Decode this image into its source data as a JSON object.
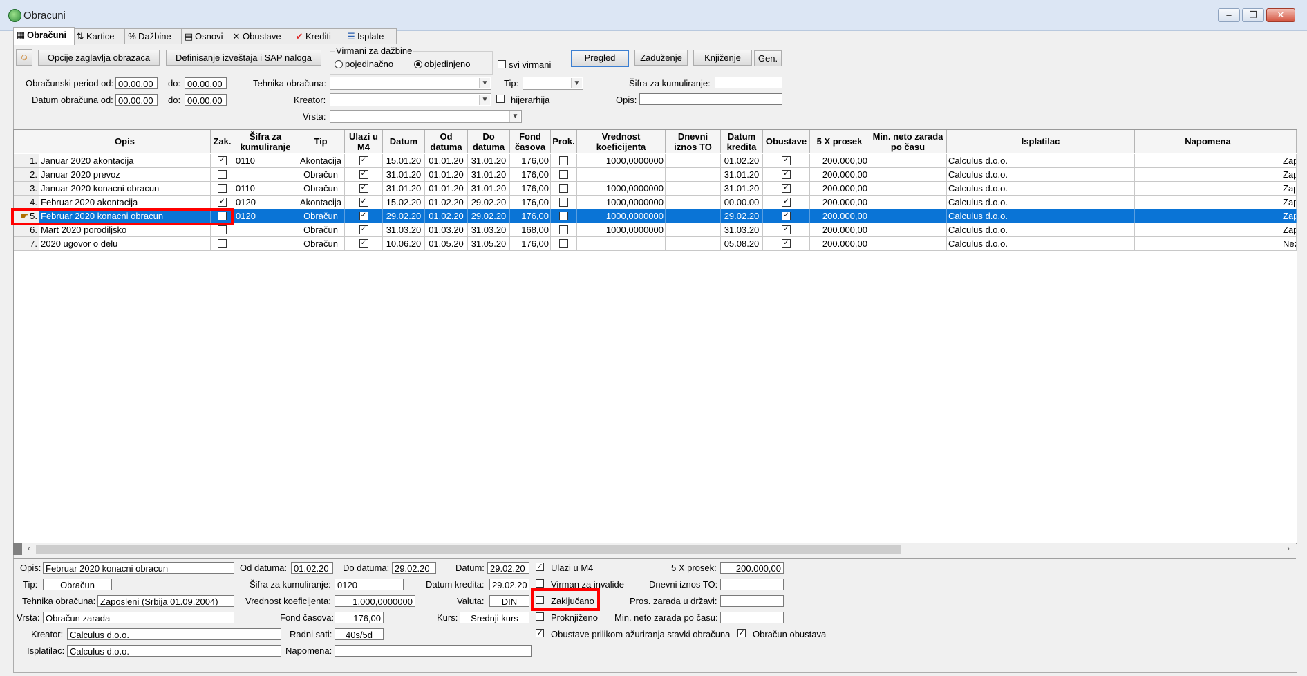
{
  "window": {
    "title": "Obracuni",
    "controls": [
      "–",
      "❐",
      "✕"
    ]
  },
  "tabs": [
    {
      "label": "Obračuni",
      "icon": "table-icon",
      "glyph": "▦"
    },
    {
      "label": "Kartice",
      "icon": "sort-icon",
      "glyph": "⇅"
    },
    {
      "label": "Dažbine",
      "icon": "percent-icon",
      "glyph": "%"
    },
    {
      "label": "Osnovi",
      "icon": "folder-icon",
      "glyph": "▤"
    },
    {
      "label": "Obustave",
      "icon": "cross-icon",
      "glyph": "✕"
    },
    {
      "label": "Krediti",
      "icon": "checkmark-icon",
      "glyph": "✔"
    },
    {
      "label": "Isplate",
      "icon": "stack-icon",
      "glyph": "☰"
    }
  ],
  "toolbar": {
    "opcije_label": "Opcije zaglavlja obrazaca",
    "definisanje_label": "Definisanje izveštaja i SAP naloga",
    "virmani_group": "Virmani za dažbine",
    "pojedinacno": "pojedinačno",
    "objedinjeno": "objedinjeno",
    "svi_virmani": "svi virmani",
    "pregled": "Pregled",
    "zaduzenje": "Zaduženje",
    "knjizenje": "Knjiženje",
    "gen": "Gen."
  },
  "filters": {
    "period_label": "Obračunski period od:",
    "period_od": "00.00.00",
    "do_label": "do:",
    "period_do": "00.00.00",
    "datum_label": "Datum obračuna od:",
    "datum_od": "00.00.00",
    "datum_do": "00.00.00",
    "tehnika_label": "Tehnika obračuna:",
    "kreator_label": "Kreator:",
    "vrsta_label": "Vrsta:",
    "tip_label": "Tip:",
    "hijerarhija": "hijerarhija",
    "sifra_label": "Šifra za kumuliranje:",
    "opis_label": "Opis:"
  },
  "grid": {
    "columns": [
      "Opis",
      "Zak.",
      "Šifra za\nkumuliranje",
      "Tip",
      "Ulazi u\nM4",
      "Datum",
      "Od\ndatuma",
      "Do\ndatuma",
      "Fond\nčasova",
      "Prok.",
      "Vrednost\nkoeficijenta",
      "Dnevni\niznos TO",
      "Datum\nkredita",
      "Obustave",
      "5 X prosek",
      "Min. neto zarada\npo času",
      "Isplatilac",
      "Napomena",
      ""
    ],
    "rows": [
      {
        "n": "1.",
        "opis": "Januar 2020 akontacija",
        "zak": true,
        "sifra": "0110",
        "tip": "Akontacija",
        "m4": true,
        "datum": "15.01.20",
        "od": "01.01.20",
        "do": "31.01.20",
        "fond": "176,00",
        "prok": false,
        "koef": "1000,0000000",
        "dnevni": "",
        "kredit": "01.02.20",
        "obust": true,
        "prosek": "200.000,00",
        "minneto": "",
        "isplatilac": "Calculus d.o.o.",
        "napomena": "",
        "extra": "Zaposl"
      },
      {
        "n": "2.",
        "opis": "Januar 2020 prevoz",
        "zak": false,
        "sifra": "",
        "tip": "Obračun",
        "m4": true,
        "datum": "31.01.20",
        "od": "01.01.20",
        "do": "31.01.20",
        "fond": "176,00",
        "prok": false,
        "koef": "",
        "dnevni": "",
        "kredit": "31.01.20",
        "obust": true,
        "prosek": "200.000,00",
        "minneto": "",
        "isplatilac": "Calculus d.o.o.",
        "napomena": "",
        "extra": "Zaposl"
      },
      {
        "n": "3.",
        "opis": "Januar 2020 konacni obracun",
        "zak": false,
        "sifra": "0110",
        "tip": "Obračun",
        "m4": true,
        "datum": "31.01.20",
        "od": "01.01.20",
        "do": "31.01.20",
        "fond": "176,00",
        "prok": false,
        "koef": "1000,0000000",
        "dnevni": "",
        "kredit": "31.01.20",
        "obust": true,
        "prosek": "200.000,00",
        "minneto": "",
        "isplatilac": "Calculus d.o.o.",
        "napomena": "",
        "extra": "Zaposl"
      },
      {
        "n": "4.",
        "opis": "Februar 2020 akontacija",
        "zak": true,
        "sifra": "0120",
        "tip": "Akontacija",
        "m4": true,
        "datum": "15.02.20",
        "od": "01.02.20",
        "do": "29.02.20",
        "fond": "176,00",
        "prok": false,
        "koef": "1000,0000000",
        "dnevni": "",
        "kredit": "00.00.00",
        "obust": true,
        "prosek": "200.000,00",
        "minneto": "",
        "isplatilac": "Calculus d.o.o.",
        "napomena": "",
        "extra": "Zaposl"
      },
      {
        "n": "5.",
        "opis": "Februar 2020 konacni obracun",
        "zak": false,
        "sifra": "0120",
        "tip": "Obračun",
        "m4": true,
        "datum": "29.02.20",
        "od": "01.02.20",
        "do": "29.02.20",
        "fond": "176,00",
        "prok": false,
        "koef": "1000,0000000",
        "dnevni": "",
        "kredit": "29.02.20",
        "obust": true,
        "prosek": "200.000,00",
        "minneto": "",
        "isplatilac": "Calculus d.o.o.",
        "napomena": "",
        "extra": "Zaposl"
      },
      {
        "n": "6.",
        "opis": "Mart 2020 porodiljsko",
        "zak": false,
        "sifra": "",
        "tip": "Obračun",
        "m4": true,
        "datum": "31.03.20",
        "od": "01.03.20",
        "do": "31.03.20",
        "fond": "168,00",
        "prok": false,
        "koef": "1000,0000000",
        "dnevni": "",
        "kredit": "31.03.20",
        "obust": true,
        "prosek": "200.000,00",
        "minneto": "",
        "isplatilac": "Calculus d.o.o.",
        "napomena": "",
        "extra": "Zaposl"
      },
      {
        "n": "7.",
        "opis": "2020 ugovor o delu",
        "zak": false,
        "sifra": "",
        "tip": "Obračun",
        "m4": true,
        "datum": "10.06.20",
        "od": "01.05.20",
        "do": "31.05.20",
        "fond": "176,00",
        "prok": false,
        "koef": "",
        "dnevni": "",
        "kredit": "05.08.20",
        "obust": true,
        "prosek": "200.000,00",
        "minneto": "",
        "isplatilac": "Calculus d.o.o.",
        "napomena": "",
        "extra": "Nezapo"
      }
    ],
    "selected_row": 4
  },
  "detail": {
    "opis_label": "Opis:",
    "opis": "Februar 2020 konacni obracun",
    "tip_label": "Tip:",
    "tip": "Obračun",
    "tehnika_label": "Tehnika obračuna:",
    "tehnika": "Zaposleni (Srbija 01.09.2004)",
    "vrsta_label": "Vrsta:",
    "vrsta": "Obračun zarada",
    "kreator_label": "Kreator:",
    "kreator": "Calculus d.o.o.",
    "isplatilac_label": "Isplatilac:",
    "isplatilac": "Calculus d.o.o.",
    "od_label": "Od datuma:",
    "od": "01.02.20",
    "do_label": "Do datuma:",
    "do": "29.02.20",
    "sifra_label": "Šifra za kumuliranje:",
    "sifra": "0120",
    "koef_label": "Vrednost koeficijenta:",
    "koef": "1.000,0000000",
    "fond_label": "Fond časova:",
    "fond": "176,00",
    "radni_label": "Radni sati:",
    "radni": "40s/5d",
    "napomena_label": "Napomena:",
    "datum_label": "Datum:",
    "datum": "29.02.20",
    "kredit_label": "Datum kredita:",
    "kredit": "29.02.20",
    "valuta_label": "Valuta:",
    "valuta": "DIN",
    "kurs_label": "Kurs:",
    "kurs": "Srednji kurs",
    "ulazi_label": "Ulazi u M4",
    "virman_label": "Virman za invalide",
    "zakljucano_label": "Zaključano",
    "proknjizeno_label": "Proknjiženo",
    "obustave_azur_label": "Obustave prilikom ažuriranja stavki obračuna",
    "obracun_obustava_label": "Obračun obustava",
    "prosek_label": "5 X prosek:",
    "prosek": "200.000,00",
    "dnevni_label": "Dnevni iznos TO:",
    "pros_zarada_label": "Pros. zarada u državi:",
    "min_neto_label": "Min. neto zarada po času:"
  },
  "colors": {
    "selection": "#0a74d6",
    "highlight": "#ff0000",
    "titlebar": "#dce6f4"
  }
}
